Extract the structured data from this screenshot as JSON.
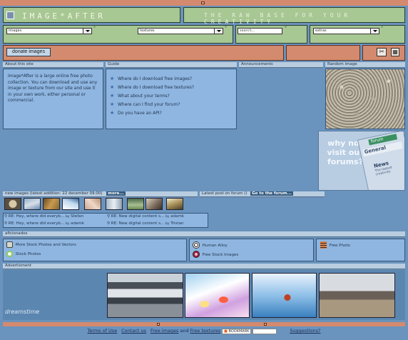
{
  "header": {
    "logo_text": "IMAGE*AFTER",
    "tagline": "THE RAW BASE FOR YOUR CREATIVITY"
  },
  "selectors": [
    {
      "value": "images"
    },
    {
      "value": "textures"
    },
    {
      "value": "search..."
    },
    {
      "value": "extras"
    }
  ],
  "toolbar": {
    "donate_label": "donate images"
  },
  "sections": {
    "about": "About this site",
    "guide": "Guide",
    "announcements": "Announcements",
    "random": "Random image",
    "new_images": "new images (latest addition: 22 december 09:00)",
    "more": "more...",
    "forum_latest": "Latest post on forum ()",
    "go_forum": "Go to the forum...",
    "aficionados": "aficionados",
    "advert": "Advertisment"
  },
  "about_text": "Image*After is a large online free photo collection. You can download and use any image or texture from our site and use it in your own work, either personal or commercial.",
  "guide_items": [
    "Where do I download free images?",
    "Where do I download free textures?",
    "What about your terms?",
    "Where can I find your forum?",
    "Do you have an API?"
  ],
  "forum_ad": {
    "text": "why not visit our forums?",
    "tab1": "forum",
    "tab2": "General",
    "tab3": "News",
    "tab3_sub": "The lastest creativity."
  },
  "posts": [
    {
      "title": "RE: Hey, where did everyb...",
      "by": "by",
      "author": "Stefan"
    },
    {
      "title": "RE: New digital content s...",
      "by": "by",
      "author": "adamk"
    },
    {
      "title": "RE: Hey, where did everyb...",
      "by": "by",
      "author": "adamk"
    },
    {
      "title": "RE: New digital content s...",
      "by": "by",
      "author": "Tristan"
    }
  ],
  "aficionados": [
    {
      "label": "More Stock Photos and Vectors",
      "icon": "camera-icon",
      "color": "#d8d8c8"
    },
    {
      "label": "Stock Photos",
      "icon": "ring-icon",
      "color": "#8ccd5a"
    },
    {
      "label": "Human Alloy",
      "icon": "target-icon",
      "color": "#222222"
    },
    {
      "label": "Free Stock Images",
      "icon": "aperture-icon",
      "color": "#a02040"
    },
    {
      "label": "Free Photo",
      "icon": "film-icon",
      "color": "#d6804a"
    }
  ],
  "ad": {
    "brand": "dreamstime"
  },
  "footer": {
    "terms": "Terms of Use",
    "contact": "Contact us",
    "free_images": "Free images",
    "and": "and",
    "free_textures": "Free textures",
    "bookmark": "BOOKMARK",
    "suggestions": "Suggestions?"
  },
  "colors": {
    "page_bg": "#6a93bd",
    "panel": "#8fb6e0",
    "header_green": "#a7c793",
    "accent_salmon": "#d48a6e"
  }
}
